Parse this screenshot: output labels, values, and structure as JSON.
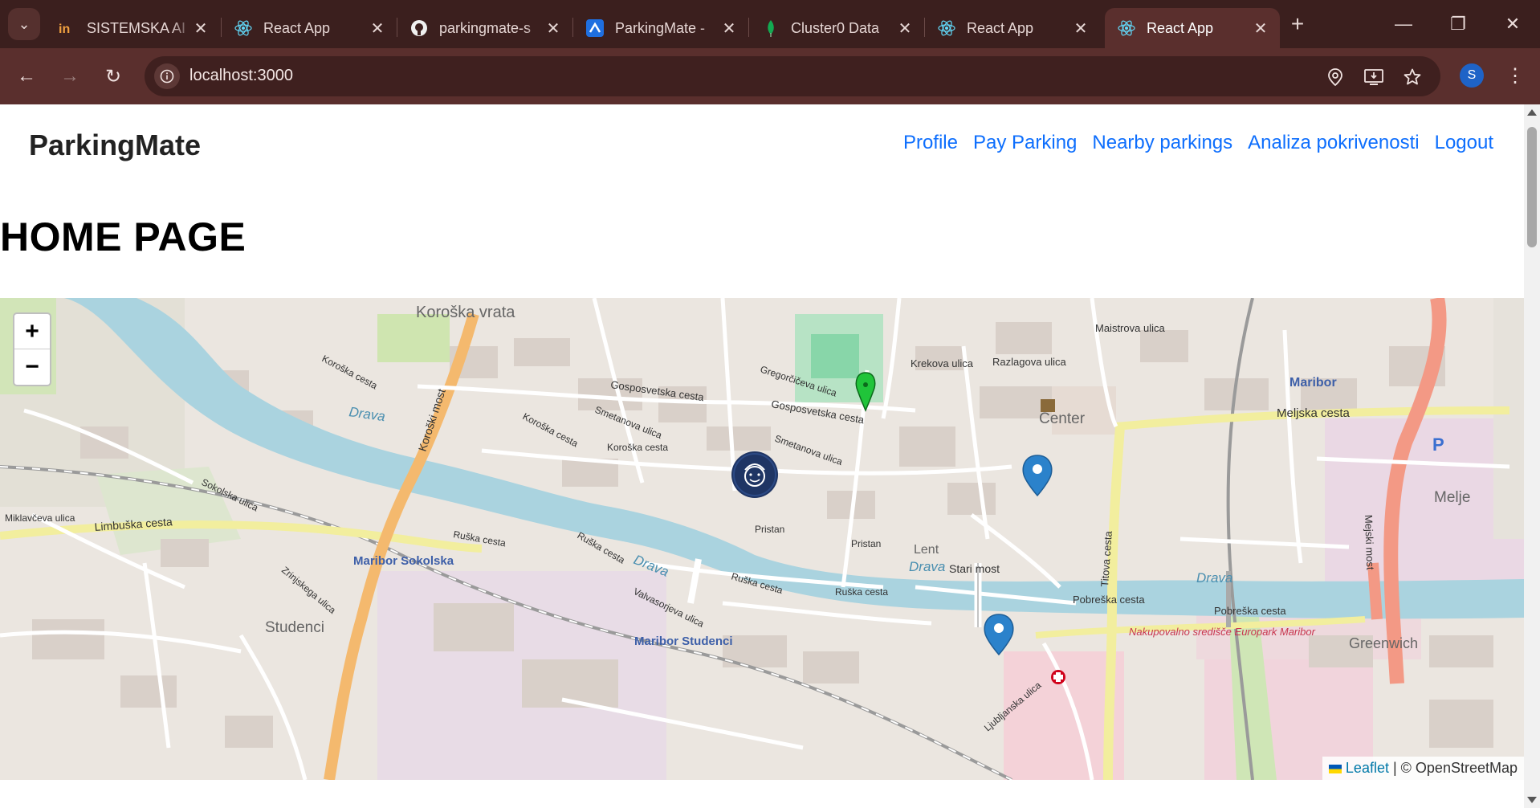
{
  "browser": {
    "tabs": [
      {
        "title": "SISTEMSKA AI",
        "icon": "in-logo-icon"
      },
      {
        "title": "React App",
        "icon": "react-icon"
      },
      {
        "title": "parkingmate-s",
        "icon": "github-icon"
      },
      {
        "title": "ParkingMate -",
        "icon": "jira-icon"
      },
      {
        "title": "Cluster0 Data",
        "icon": "mongodb-leaf-icon"
      },
      {
        "title": "React App",
        "icon": "react-icon"
      },
      {
        "title": "React App",
        "icon": "react-icon",
        "active": true
      }
    ],
    "url": "localhost:3000",
    "profile_initial": "S"
  },
  "app": {
    "brand": "ParkingMate",
    "nav": [
      "Profile",
      "Pay Parking",
      "Nearby parkings",
      "Analiza pokrivenosti",
      "Logout"
    ],
    "heading": "HOME PAGE"
  },
  "map": {
    "zoom_in": "+",
    "zoom_out": "−",
    "attribution_link": "Leaflet",
    "attribution_text": "| © OpenStreetMap",
    "labels": {
      "koroska_vrata": "Koroška vrata",
      "drava1": "Drava",
      "drava2": "Drava",
      "drava3": "Drava",
      "drava4": "Drava",
      "koroski_most": "Koroški most",
      "center": "Center",
      "lent": "Lent",
      "stari_most": "Stari most",
      "maribor": "Maribor",
      "maribor_sokolska": "Maribor Sokolska",
      "maribor_studenci": "Maribor Studenci",
      "studenci": "Studenci",
      "melje": "Melje",
      "greenwich": "Greenwich",
      "europark": "Nakupovalno središče Europark Maribor",
      "gosposvetska1": "Gosposvetska cesta",
      "gosposvetska2": "Gosposvetska cesta",
      "koroska1": "Koroška cesta",
      "koroska2": "Koroška cesta",
      "koroska3": "Koroška cesta",
      "limbuska": "Limbuška cesta",
      "ruska1": "Ruška cesta",
      "ruska2": "Ruška cesta",
      "ruska3": "Ruška cesta",
      "ruska4": "Ruška cesta",
      "valvasorjeva": "Valvasorjeva ulica",
      "pobreska1": "Pobreška cesta",
      "pobreska2": "Pobreška cesta",
      "meljska": "Meljska cesta",
      "maistrova": "Maistrova ulica",
      "krekova": "Krekova ulica",
      "razlagova": "Razlagova ulica",
      "pristan1": "Pristan",
      "pristan2": "Pristan",
      "mejski_most": "Mejski most",
      "titova": "Titova cesta",
      "smetanova1": "Smetanova ulica",
      "smetanova2": "Smetanova ulica",
      "gregorciceva": "Gregorčičeva ulica",
      "miklavceva": "Miklavčeva ulica",
      "sokolska": "Sokolska ulica",
      "zrinjskega": "Zrinjskega ulica",
      "ljubljanska": "Ljubljanska ulica",
      "p_sign": "P"
    }
  }
}
